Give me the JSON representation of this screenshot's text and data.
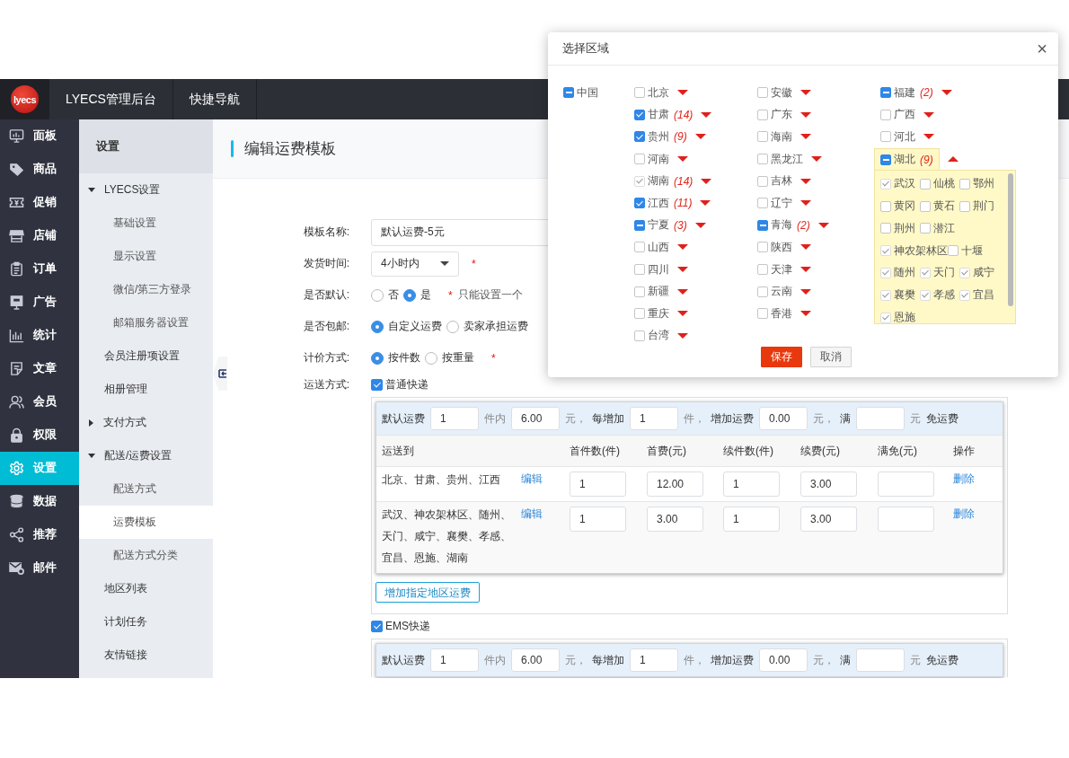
{
  "topbar": {
    "logo_text": "lyecs",
    "items": [
      "LYECS管理后台",
      "快捷导航"
    ]
  },
  "main_nav": [
    {
      "label": "面板",
      "selected": false
    },
    {
      "label": "商品",
      "selected": false
    },
    {
      "label": "促销",
      "selected": false
    },
    {
      "label": "店铺",
      "selected": false
    },
    {
      "label": "订单",
      "selected": false
    },
    {
      "label": "广告",
      "selected": false
    },
    {
      "label": "统计",
      "selected": false
    },
    {
      "label": "文章",
      "selected": false
    },
    {
      "label": "会员",
      "selected": false
    },
    {
      "label": "权限",
      "selected": false
    },
    {
      "label": "设置",
      "selected": true
    },
    {
      "label": "数据",
      "selected": false
    },
    {
      "label": "推荐",
      "selected": false
    },
    {
      "label": "邮件",
      "selected": false
    }
  ],
  "sub_nav": {
    "title": "设置",
    "items": [
      {
        "label": "LYECS设置",
        "selected": false,
        "expanded": true,
        "children": [
          {
            "label": "基础设置",
            "selected": false
          },
          {
            "label": "显示设置",
            "selected": false
          },
          {
            "label": "微信/第三方登录",
            "selected": false
          },
          {
            "label": "邮箱服务器设置",
            "selected": false
          }
        ]
      },
      {
        "label": "会员注册项设置",
        "selected": false
      },
      {
        "label": "相册管理",
        "selected": false
      },
      {
        "label": "支付方式",
        "selected": false,
        "expanded": false
      },
      {
        "label": "配送/运费设置",
        "selected": false,
        "expanded": true,
        "children": [
          {
            "label": "配送方式",
            "selected": false
          },
          {
            "label": "运费模板",
            "selected": true
          },
          {
            "label": "配送方式分类",
            "selected": false
          }
        ]
      },
      {
        "label": "地区列表",
        "selected": false
      },
      {
        "label": "计划任务",
        "selected": false
      },
      {
        "label": "友情链接",
        "selected": false
      }
    ]
  },
  "page_title": "编辑运费模板",
  "form": {
    "name": {
      "label": "模板名称:",
      "value": "默认运费-5元"
    },
    "ship_time": {
      "label": "发货时间:",
      "value": "4小时内",
      "required_mark": "*"
    },
    "is_default": {
      "label": "是否默认:",
      "options": [
        {
          "label": "否",
          "selected": false
        },
        {
          "label": "是",
          "selected": true
        }
      ],
      "required_mark": "*",
      "hint": "只能设置一个"
    },
    "free_shipping": {
      "label": "是否包邮:",
      "options": [
        {
          "label": "自定义运费",
          "selected": true
        },
        {
          "label": "卖家承担运费",
          "selected": false
        }
      ]
    },
    "pricing": {
      "label": "计价方式:",
      "options": [
        {
          "label": "按件数",
          "selected": true
        },
        {
          "label": "按重量",
          "selected": false
        }
      ],
      "required_mark": "*"
    },
    "methods": {
      "label": "运送方式:",
      "items": [
        {
          "name": "普通快递",
          "checked": true,
          "default_row": [
            {
              "kind": "text",
              "text": "默认运费",
              "muted": false
            },
            {
              "kind": "input",
              "value": "1"
            },
            {
              "kind": "text",
              "text": "件内",
              "muted": true
            },
            {
              "kind": "input",
              "value": "6.00"
            },
            {
              "kind": "text",
              "text": "元，",
              "muted": true
            },
            {
              "kind": "text",
              "text": "每增加",
              "muted": false
            },
            {
              "kind": "input",
              "value": "1"
            },
            {
              "kind": "text",
              "text": "件，",
              "muted": true
            },
            {
              "kind": "text",
              "text": "增加运费",
              "muted": false
            },
            {
              "kind": "input",
              "value": "0.00"
            },
            {
              "kind": "text",
              "text": "元，",
              "muted": true
            },
            {
              "kind": "text",
              "text": "满",
              "muted": false
            },
            {
              "kind": "input"
            },
            {
              "kind": "text",
              "text": "元",
              "muted": true
            },
            {
              "kind": "text",
              "text": "免运费",
              "muted": false
            }
          ],
          "table": {
            "columns": [
              "运送到",
              "首件数(件)",
              "首费(元)",
              "续件数(件)",
              "续费(元)",
              "满免(元)",
              "操作"
            ],
            "rows": [
              {
                "regions": "北京、甘肃、贵州、江西",
                "edit": "编辑",
                "inputs": [
                  "1",
                  "12.00",
                  "1",
                  "3.00"
                ],
                "delete": "删除"
              },
              {
                "regions": "武汉、神农架林区、随州、天门、咸宁、襄樊、孝感、宜昌、恩施、湖南",
                "edit": "编辑",
                "inputs": [
                  "1",
                  "3.00",
                  "1",
                  "3.00"
                ],
                "delete": "删除"
              }
            ]
          },
          "add_button": "增加指定地区运费"
        },
        {
          "name": "EMS快递",
          "checked": true,
          "default_row": [
            {
              "kind": "text",
              "text": "默认运费",
              "muted": false
            },
            {
              "kind": "input",
              "value": "1"
            },
            {
              "kind": "text",
              "text": "件内",
              "muted": true
            },
            {
              "kind": "input",
              "value": "6.00"
            },
            {
              "kind": "text",
              "text": "元，",
              "muted": true
            },
            {
              "kind": "text",
              "text": "每增加",
              "muted": false
            },
            {
              "kind": "input",
              "value": "1"
            },
            {
              "kind": "text",
              "text": "件，",
              "muted": true
            },
            {
              "kind": "text",
              "text": "增加运费",
              "muted": false
            },
            {
              "kind": "input",
              "value": "0.00"
            },
            {
              "kind": "text",
              "text": "元，",
              "muted": true
            },
            {
              "kind": "text",
              "text": "满",
              "muted": false
            },
            {
              "kind": "input"
            },
            {
              "kind": "text",
              "text": "元",
              "muted": true
            },
            {
              "kind": "text",
              "text": "免运费",
              "muted": false
            }
          ]
        }
      ]
    }
  },
  "region_dialog": {
    "title": "选择区域",
    "close": "×",
    "root": {
      "name": "中国",
      "checked": false,
      "indeterminate": true,
      "disabled": false
    },
    "columns": [
      [
        {
          "name": "北京",
          "checked": false,
          "indeterminate": false,
          "disabled": false,
          "expanded": false
        },
        {
          "name": "甘肃",
          "count": "(14)",
          "checked": true,
          "indeterminate": false,
          "disabled": false,
          "expanded": false
        },
        {
          "name": "贵州",
          "count": "(9)",
          "checked": true,
          "indeterminate": false,
          "disabled": false,
          "expanded": false
        },
        {
          "name": "河南",
          "checked": false,
          "indeterminate": false,
          "disabled": false,
          "expanded": false
        },
        {
          "name": "湖南",
          "count": "(14)",
          "checked": true,
          "indeterminate": false,
          "disabled": true,
          "expanded": false
        },
        {
          "name": "江西",
          "count": "(11)",
          "checked": true,
          "indeterminate": false,
          "disabled": false,
          "expanded": false
        },
        {
          "name": "宁夏",
          "count": "(3)",
          "checked": false,
          "indeterminate": true,
          "disabled": false,
          "expanded": false
        },
        {
          "name": "山西",
          "checked": false,
          "indeterminate": false,
          "disabled": false,
          "expanded": false
        },
        {
          "name": "四川",
          "checked": false,
          "indeterminate": false,
          "disabled": false,
          "expanded": false
        },
        {
          "name": "新疆",
          "checked": false,
          "indeterminate": false,
          "disabled": false,
          "expanded": false
        },
        {
          "name": "重庆",
          "checked": false,
          "indeterminate": false,
          "disabled": false,
          "expanded": false
        },
        {
          "name": "台湾",
          "checked": false,
          "indeterminate": false,
          "disabled": false,
          "expanded": false
        }
      ],
      [
        {
          "name": "安徽",
          "checked": false,
          "indeterminate": false,
          "disabled": false,
          "expanded": false
        },
        {
          "name": "广东",
          "checked": false,
          "indeterminate": false,
          "disabled": false,
          "expanded": false
        },
        {
          "name": "海南",
          "checked": false,
          "indeterminate": false,
          "disabled": false,
          "expanded": false
        },
        {
          "name": "黑龙江",
          "checked": false,
          "indeterminate": false,
          "disabled": false,
          "expanded": false
        },
        {
          "name": "吉林",
          "checked": false,
          "indeterminate": false,
          "disabled": false,
          "expanded": false
        },
        {
          "name": "辽宁",
          "checked": false,
          "indeterminate": false,
          "disabled": false,
          "expanded": false
        },
        {
          "name": "青海",
          "count": "(2)",
          "checked": false,
          "indeterminate": true,
          "disabled": false,
          "expanded": false
        },
        {
          "name": "陕西",
          "checked": false,
          "indeterminate": false,
          "disabled": false,
          "expanded": false
        },
        {
          "name": "天津",
          "checked": false,
          "indeterminate": false,
          "disabled": false,
          "expanded": false
        },
        {
          "name": "云南",
          "checked": false,
          "indeterminate": false,
          "disabled": false,
          "expanded": false
        },
        {
          "name": "香港",
          "checked": false,
          "indeterminate": false,
          "disabled": false,
          "expanded": false
        }
      ],
      [
        {
          "name": "福建",
          "count": "(2)",
          "checked": false,
          "indeterminate": true,
          "disabled": false,
          "expanded": false
        },
        {
          "name": "广西",
          "checked": false,
          "indeterminate": false,
          "disabled": false,
          "expanded": false
        },
        {
          "name": "河北",
          "checked": false,
          "indeterminate": false,
          "disabled": false,
          "expanded": false
        },
        {
          "name": "湖北",
          "count": "(9)",
          "checked": false,
          "indeterminate": true,
          "disabled": false,
          "expanded": true,
          "cities": [
            {
              "name": "武汉",
              "checked": true,
              "disabled": true
            },
            {
              "name": "仙桃",
              "checked": false,
              "disabled": false
            },
            {
              "name": "鄂州",
              "checked": false,
              "disabled": false
            },
            {
              "name": "黄冈",
              "checked": false,
              "disabled": false
            },
            {
              "name": "黄石",
              "checked": false,
              "disabled": false
            },
            {
              "name": "荆门",
              "checked": false,
              "disabled": false
            },
            {
              "name": "荆州",
              "checked": false,
              "disabled": false
            },
            {
              "name": "潜江",
              "checked": false,
              "disabled": false
            },
            {
              "name": "神农架林区",
              "checked": true,
              "disabled": true
            },
            {
              "name": "十堰",
              "checked": false,
              "disabled": false
            },
            {
              "name": "随州",
              "checked": true,
              "disabled": true
            },
            {
              "name": "天门",
              "checked": true,
              "disabled": true
            },
            {
              "name": "咸宁",
              "checked": true,
              "disabled": true
            },
            {
              "name": "襄樊",
              "checked": true,
              "disabled": true
            },
            {
              "name": "孝感",
              "checked": true,
              "disabled": true
            },
            {
              "name": "宜昌",
              "checked": true,
              "disabled": true
            },
            {
              "name": "恩施",
              "checked": true,
              "disabled": true
            }
          ]
        }
      ]
    ],
    "buttons": [
      {
        "label": "保存",
        "kind": "primary"
      },
      {
        "label": "取消",
        "kind": "default"
      }
    ]
  }
}
